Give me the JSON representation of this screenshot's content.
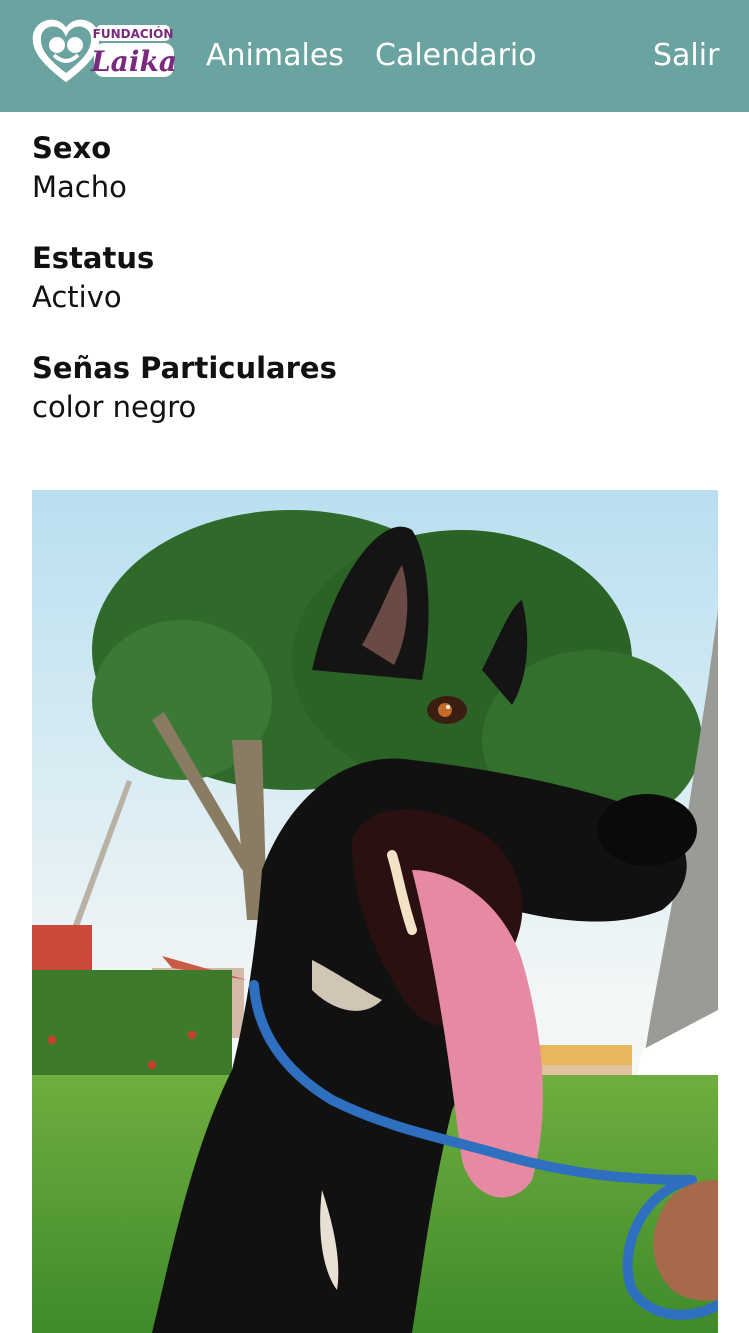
{
  "brand": {
    "top_text": "FUNDACIÓN",
    "name": "Laika"
  },
  "nav": {
    "animals": "Animales",
    "calendar": "Calendario",
    "logout": "Salir"
  },
  "fields": [
    {
      "label": "Sexo",
      "value": "Macho"
    },
    {
      "label": "Estatus",
      "value": "Activo"
    },
    {
      "label": "Señas Particulares",
      "value": "color negro"
    }
  ],
  "photo": {
    "subject": "black dog with blue leash"
  },
  "colors": {
    "navbar": "#6aa39f",
    "brand_purple": "#7a2a7e",
    "leash": "#2f6fc0"
  }
}
